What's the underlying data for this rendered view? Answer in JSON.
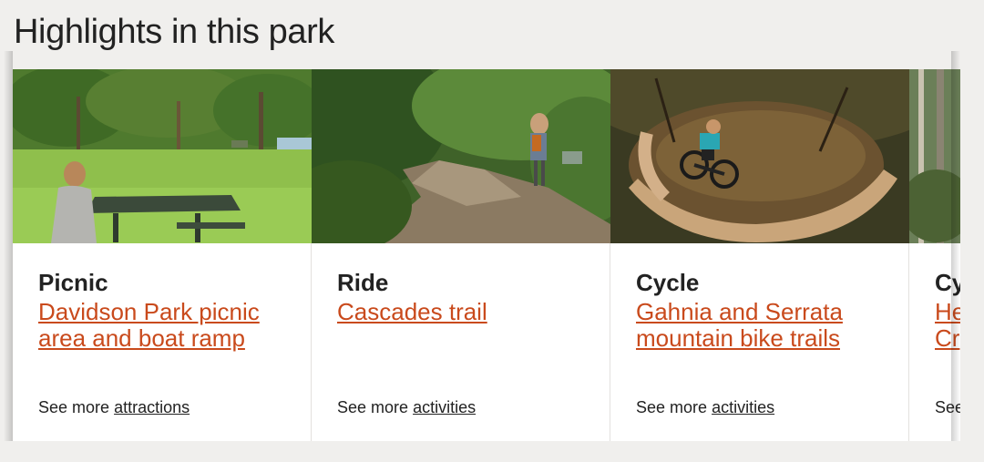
{
  "section": {
    "title": "Highlights in this park"
  },
  "cards": [
    {
      "type": "Picnic",
      "title": "Davidson Park picnic area and boat ramp",
      "more_prefix": "See more",
      "more_link": "attractions",
      "image": "picnic-photo"
    },
    {
      "type": "Ride",
      "title": "Cascades trail",
      "more_prefix": "See more",
      "more_link": "activities",
      "image": "trail-photo"
    },
    {
      "type": "Cycle",
      "title": "Gahnia and Serrata mountain bike trails",
      "more_prefix": "See more",
      "more_link": "activities",
      "image": "mountain-bike-photo"
    },
    {
      "type": "Cy",
      "title": "He Cr",
      "more_prefix": "See",
      "more_link": "",
      "image": "forest-photo"
    }
  ],
  "colors": {
    "link": "#c94a1c",
    "background": "#f0efed"
  }
}
